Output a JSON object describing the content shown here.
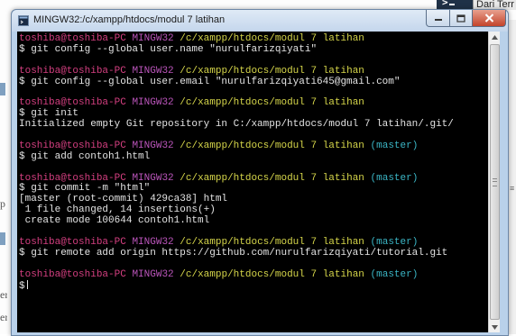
{
  "background": {
    "top_tab_label": "Dari Terr",
    "left_fragments": [
      "p",
      "er",
      "er"
    ]
  },
  "window": {
    "title": "MINGW32:/c/xampp/htdocs/modul 7 latihan"
  },
  "console": {
    "blocks": [
      {
        "prompt": {
          "user": "toshiba@toshiba-PC",
          "system": "MINGW32",
          "path": "/c/xampp/htdocs/modul 7 latihan",
          "branch": ""
        },
        "command": "$ git config --global user.name \"nurulfarizqiyati\"",
        "output": []
      },
      {
        "prompt": {
          "user": "toshiba@toshiba-PC",
          "system": "MINGW32",
          "path": "/c/xampp/htdocs/modul 7 latihan",
          "branch": ""
        },
        "command": "$ git config --global user.email \"nurulfarizqiyati645@gmail.com\"",
        "output": []
      },
      {
        "prompt": {
          "user": "toshiba@toshiba-PC",
          "system": "MINGW32",
          "path": "/c/xampp/htdocs/modul 7 latihan",
          "branch": ""
        },
        "command": "$ git init",
        "output": [
          "Initialized empty Git repository in C:/xampp/htdocs/modul 7 latihan/.git/"
        ]
      },
      {
        "prompt": {
          "user": "toshiba@toshiba-PC",
          "system": "MINGW32",
          "path": "/c/xampp/htdocs/modul 7 latihan",
          "branch": "(master)"
        },
        "command": "$ git add contoh1.html",
        "output": []
      },
      {
        "prompt": {
          "user": "toshiba@toshiba-PC",
          "system": "MINGW32",
          "path": "/c/xampp/htdocs/modul 7 latihan",
          "branch": "(master)"
        },
        "command": "$ git commit -m \"html\"",
        "output": [
          "[master (root-commit) 429ca38] html",
          " 1 file changed, 14 insertions(+)",
          " create mode 100644 contoh1.html"
        ]
      },
      {
        "prompt": {
          "user": "toshiba@toshiba-PC",
          "system": "MINGW32",
          "path": "/c/xampp/htdocs/modul 7 latihan",
          "branch": "(master)"
        },
        "command": "$ git remote add origin https://github.com/nurulfarizqiyati/tutorial.git",
        "output": []
      },
      {
        "prompt": {
          "user": "toshiba@toshiba-PC",
          "system": "MINGW32",
          "path": "/c/xampp/htdocs/modul 7 latihan",
          "branch": "(master)"
        },
        "command": "$",
        "output": [],
        "cursor": true
      }
    ]
  },
  "colors": {
    "user": "#d43f80",
    "system": "#bb55bb",
    "path": "#d6d64a",
    "branch": "#3bb6c6",
    "console_bg": "#000000"
  },
  "icons": {
    "app": "mingw-terminal-icon",
    "minimize": "minimize-icon",
    "maximize": "maximize-icon",
    "close": "close-icon"
  }
}
